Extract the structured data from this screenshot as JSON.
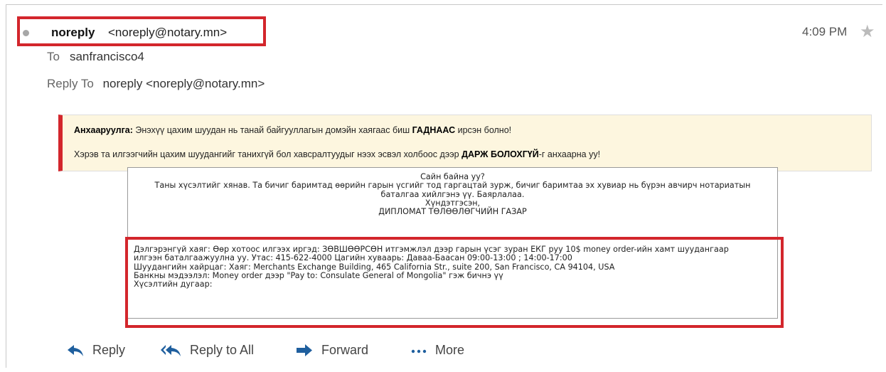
{
  "message": {
    "sender_name": "noreply",
    "sender_email": "<noreply@notary.mn>",
    "time": "4:09 PM",
    "to_label": "To",
    "to_value": "sanfrancisco4",
    "reply_to_label": "Reply To",
    "reply_to_name": "noreply",
    "reply_to_email": "<noreply@notary.mn>"
  },
  "warning": {
    "line1_label": "Анхааруулга:",
    "line1_text": " Энэхүү цахим шуудан нь танай байгууллагын домэйн хаягаас биш ",
    "line1_bold": "ГАДНААС",
    "line1_end": " ирсэн болно!",
    "line2_text": "Хэрэв та илгээгчийн цахим шуудангийг танихгүй бол хавсралтуудыг нээх эсвэл холбоос дээр ",
    "line2_bold": "ДАРЖ БОЛОХГҮЙ",
    "line2_end": "-г анхаарна уу!"
  },
  "body": {
    "greeting": "Сайн байна уу?",
    "line1": "Таны хүсэлтийг хянав. Та бичиг баримтад өөрийн гарын үсгийг тод гаргацтай зурж, бичиг баримтаа эх хувиар нь бүрэн авчирч нотариатын баталгаа хийлгэнэ үү. Баярлалаа.",
    "regards": "Хүндэтгэсэн,",
    "org": "ДИПЛОМАТ ТӨЛӨӨЛӨГЧИЙН ГАЗАР",
    "detail1": "Дэлгэрэнгүй хаяг: Өөр хотоос илгээх иргэд: ЗӨВШӨӨРСӨН итгэмжлэл дээр гарын үсэг зуран ЕКГ руу 10$ money order-ийн хамт шуудангаар илгээн баталгаажуулна уу. Утас: 415-622-4000 Цагийн хуваарь: Даваа-Баасан 09:00-13:00 ; 14:00-17:00",
    "detail2": "Шуудангийн хайрцаг: Хаяг: Merchants Exchange Building, 465 California Str., suite 200, San Francisco, CA 94104, USA",
    "detail3": "Банкны мэдээлэл: Money order дээр \"Pay to: Consulate General of Mongolia\" гэж бичнэ үү",
    "detail4": "Хүсэлтийн дугаар:"
  },
  "actions": {
    "reply": "Reply",
    "reply_all": "Reply to All",
    "forward": "Forward",
    "more": "More"
  },
  "colors": {
    "highlight": "#d3262c",
    "warning_bg": "#fdf6df",
    "icon_blue": "#1f5f9e"
  },
  "icons": [
    "unread-dot-icon",
    "star-icon",
    "reply-icon",
    "reply-all-icon",
    "forward-icon",
    "more-icon"
  ]
}
